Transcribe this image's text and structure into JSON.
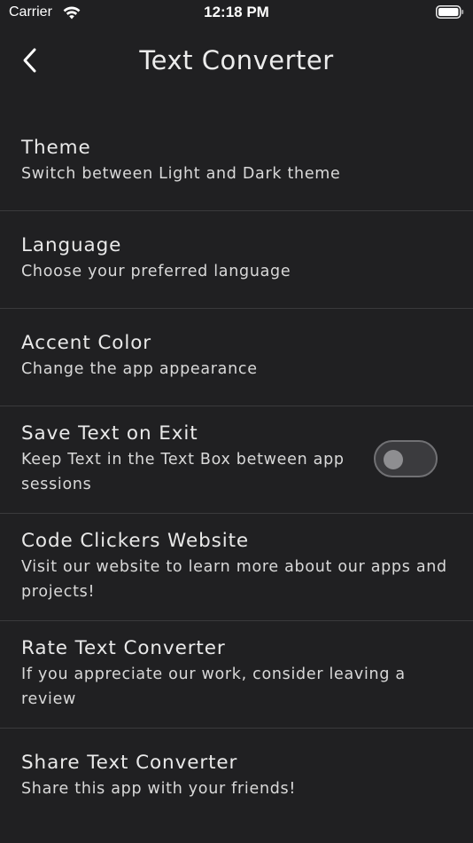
{
  "status_bar": {
    "carrier": "Carrier",
    "time": "12:18 PM",
    "wifi_icon": "wifi-icon",
    "battery_icon": "battery-icon"
  },
  "nav": {
    "title": "Text Converter",
    "back_icon": "chevron-left-icon"
  },
  "settings": {
    "items": [
      {
        "title": "Theme",
        "subtitle": "Switch between Light and Dark theme"
      },
      {
        "title": "Language",
        "subtitle": "Choose your preferred language"
      },
      {
        "title": "Accent Color",
        "subtitle": "Change the app appearance"
      },
      {
        "title": "Save Text on Exit",
        "subtitle": "Keep Text in the Text Box between app sessions",
        "toggle_on": false
      },
      {
        "title": "Code Clickers Website",
        "subtitle": "Visit our website to learn more about our apps and projects!"
      },
      {
        "title": "Rate Text Converter",
        "subtitle": "If you appreciate our work, consider leaving a review"
      },
      {
        "title": "Share Text Converter",
        "subtitle": "Share this app with your friends!"
      }
    ]
  },
  "colors": {
    "background": "#202022",
    "divider": "#3a3a3c",
    "text": "#e9e9e9"
  }
}
